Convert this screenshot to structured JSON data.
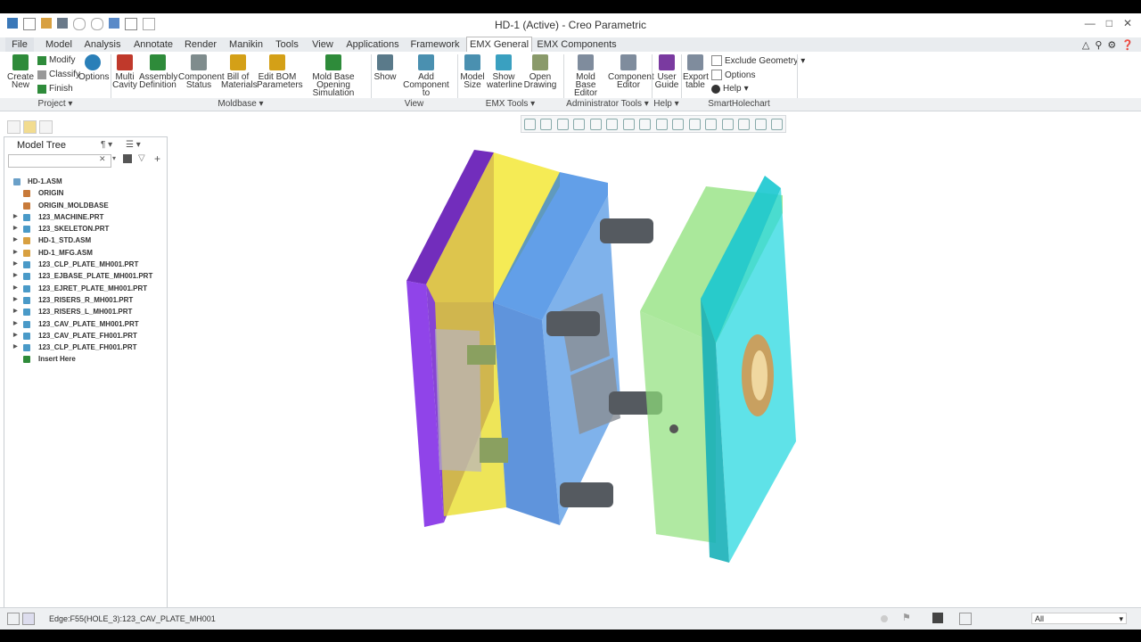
{
  "window": {
    "title": "HD-1 (Active) - Creo Parametric"
  },
  "tabs": [
    "File",
    "Model",
    "Analysis",
    "Annotate",
    "Render",
    "Manikin",
    "Tools",
    "View",
    "Applications",
    "Framework",
    "EMX General",
    "EMX Components"
  ],
  "active_tab": "EMX General",
  "ribbon": {
    "buttons": [
      {
        "label1": "Create",
        "label2": "New",
        "color": "#2e8b3a"
      },
      {
        "label1": "Options",
        "label2": "",
        "color": "#2a7fb8"
      },
      {
        "label1": "Multi",
        "label2": "Cavity",
        "color": "#c0392b"
      },
      {
        "label1": "Assembly",
        "label2": "Definition",
        "color": "#2e8b3a"
      },
      {
        "label1": "Component",
        "label2": "Status",
        "color": "#7f8c8d"
      },
      {
        "label1": "Bill of",
        "label2": "Materials",
        "color": "#d4a017"
      },
      {
        "label1": "Edit BOM",
        "label2": "Parameters",
        "color": "#d4a017"
      },
      {
        "label1": "Mold Base",
        "label2": "Opening Simulation",
        "color": "#2e8b3a"
      },
      {
        "label1": "Show",
        "label2": "",
        "color": "#5a7a8a"
      },
      {
        "label1": "Add Component",
        "label2": "to",
        "color": "#4a90b0"
      },
      {
        "label1": "Model",
        "label2": "Size",
        "color": "#4a90b0"
      },
      {
        "label1": "Show",
        "label2": "waterline",
        "color": "#3aa0c0"
      },
      {
        "label1": "Open",
        "label2": "Drawing",
        "color": "#8a9a6a"
      },
      {
        "label1": "Mold Base",
        "label2": "Editor",
        "color": "#7f8c9d"
      },
      {
        "label1": "Component",
        "label2": "Editor",
        "color": "#7f8c9d"
      },
      {
        "label1": "User",
        "label2": "Guide",
        "color": "#7a3aa0"
      },
      {
        "label1": "Export",
        "label2": "table",
        "color": "#7f8c9d"
      }
    ],
    "project_small": [
      "Modify",
      "Classify",
      "Finish"
    ],
    "smart_small": [
      "Exclude Geometry",
      "Options",
      "Help"
    ],
    "groups": [
      "Project",
      "Moldbase",
      "View",
      "EMX Tools",
      "Administrator Tools",
      "Help",
      "SmartHolechart"
    ]
  },
  "model_tree": {
    "title": "Model Tree",
    "items": [
      {
        "label": "HD-1.ASM",
        "expandable": false,
        "icon_color": "#6aa0c8"
      },
      {
        "label": "ORIGIN",
        "expandable": false,
        "icon_color": "#c87a3a"
      },
      {
        "label": "ORIGIN_MOLDBASE",
        "expandable": false,
        "icon_color": "#c87a3a"
      },
      {
        "label": "123_MACHINE.PRT",
        "expandable": true,
        "icon_color": "#4a9ac8"
      },
      {
        "label": "123_SKELETON.PRT",
        "expandable": true,
        "icon_color": "#4a9ac8"
      },
      {
        "label": "HD-1_STD.ASM",
        "expandable": true,
        "icon_color": "#d8a040"
      },
      {
        "label": "HD-1_MFG.ASM",
        "expandable": true,
        "icon_color": "#d8a040"
      },
      {
        "label": "123_CLP_PLATE_MH001.PRT",
        "expandable": true,
        "icon_color": "#4a9ac8"
      },
      {
        "label": "123_EJBASE_PLATE_MH001.PRT",
        "expandable": true,
        "icon_color": "#4a9ac8"
      },
      {
        "label": "123_EJRET_PLATE_MH001.PRT",
        "expandable": true,
        "icon_color": "#4a9ac8"
      },
      {
        "label": "123_RISERS_R_MH001.PRT",
        "expandable": true,
        "icon_color": "#4a9ac8"
      },
      {
        "label": "123_RISERS_L_MH001.PRT",
        "expandable": true,
        "icon_color": "#4a9ac8"
      },
      {
        "label": "123_CAV_PLATE_MH001.PRT",
        "expandable": true,
        "icon_color": "#4a9ac8"
      },
      {
        "label": "123_CAV_PLATE_FH001.PRT",
        "expandable": true,
        "icon_color": "#4a9ac8"
      },
      {
        "label": "123_CLP_PLATE_FH001.PRT",
        "expandable": true,
        "icon_color": "#4a9ac8"
      },
      {
        "label": "Insert Here",
        "expandable": false,
        "icon_color": "#2e8b3a"
      }
    ]
  },
  "status": {
    "message": "Edge:F55(HOLE_3):123_CAV_PLATE_MH001",
    "filter_value": "All"
  },
  "colors": {
    "purple_plate": "#8a3ae8",
    "yellow_plate": "#f2e62a",
    "blue_plate": "#2e7fe0",
    "green_plate": "#8ee07a",
    "cyan_plate": "#2ad8e0"
  }
}
